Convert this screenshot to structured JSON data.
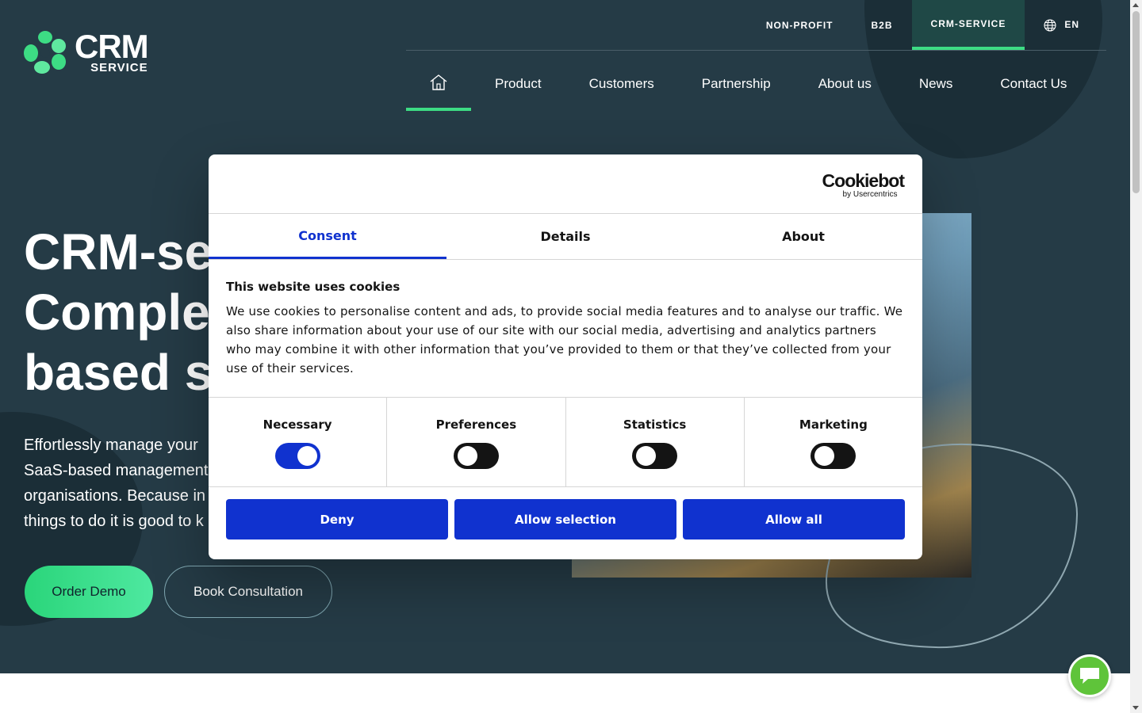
{
  "brand": {
    "logo_big": "CRM",
    "logo_small": "SERVICE"
  },
  "topnav": {
    "items": [
      "NON-PROFIT",
      "B2B",
      "CRM-SERVICE"
    ],
    "active": "CRM-SERVICE",
    "language": "EN"
  },
  "mainnav": {
    "items": [
      "Product",
      "Customers",
      "Partnership",
      "About us",
      "News",
      "Contact Us"
    ]
  },
  "hero": {
    "title_lines": [
      "CRM-se",
      "Complet",
      "based so"
    ],
    "subtitle_lines": [
      "Effortlessly manage your",
      "SaaS-based management",
      "organisations. Because in",
      "things to do it is good to k"
    ],
    "cta_primary": "Order Demo",
    "cta_secondary": "Book Consultation"
  },
  "cookie": {
    "brand": "Cookiebot",
    "brand_sub": "by Usercentrics",
    "tabs": [
      "Consent",
      "Details",
      "About"
    ],
    "active_tab": "Consent",
    "title": "This website uses cookies",
    "text": "We use cookies to personalise content and ads, to provide social media features and to analyse our traffic. We also share information about your use of our site with our social media, advertising and analytics partners who may combine it with other information that you’ve provided to them or that they’ve collected from your use of their services.",
    "toggles": [
      {
        "label": "Necessary",
        "on": true
      },
      {
        "label": "Preferences",
        "on": false
      },
      {
        "label": "Statistics",
        "on": false
      },
      {
        "label": "Marketing",
        "on": false
      }
    ],
    "buttons": [
      "Deny",
      "Allow selection",
      "Allow all"
    ]
  },
  "colors": {
    "hero_bg": "#253b46",
    "accent_green": "#3ddc84",
    "cookie_blue": "#1032cf",
    "chat_green": "#5fc43a"
  },
  "icons": [
    "home-icon",
    "globe-icon",
    "chat-icon"
  ]
}
